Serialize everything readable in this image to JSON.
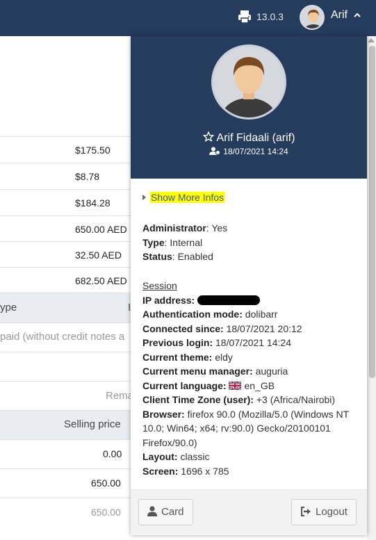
{
  "topbar": {
    "version": "13.0.3",
    "user": "Arif"
  },
  "background": {
    "amounts": [
      "$175.50",
      "$8.78",
      "$184.28",
      "650.00 AED",
      "32.50 AED",
      "682.50 AED"
    ],
    "table_header_partial": "ype",
    "table_header_right_partial": "I",
    "paid_note_partial": "paid (without credit notes a",
    "remain_partial": "Rema",
    "selling_price_header": "Selling price",
    "prices": [
      "0.00",
      "650.00",
      "650.00"
    ]
  },
  "panel": {
    "fullname": "Arif Fidaali (arif)",
    "last_login": "18/07/2021 14:24",
    "show_more": "Show More Infos",
    "fields": {
      "administrator": {
        "label": "Administrator",
        "value": "Yes"
      },
      "type": {
        "label": "Type",
        "value": "Internal"
      },
      "status": {
        "label": "Status",
        "value": "Enabled"
      }
    },
    "session": {
      "title": "Session",
      "ip_label": "IP address:",
      "auth_label": "Authentication mode:",
      "auth_value": "dolibarr",
      "connected_label": "Connected since:",
      "connected_value": "18/07/2021 20:12",
      "prev_label": "Previous login:",
      "prev_value": "18/07/2021 14:24",
      "theme_label": "Current theme:",
      "theme_value": "eldy",
      "menu_label": "Current menu manager:",
      "menu_value": "auguria",
      "lang_label": "Current language:",
      "lang_value": "en_GB",
      "tz_label": "Client Time Zone (user):",
      "tz_value": "+3 (Africa/Nairobi)",
      "browser_label": "Browser:",
      "browser_value": "firefox 90.0 (Mozilla/5.0 (Windows NT 10.0; Win64; x64; rv:90.0) Gecko/20100101 Firefox/90.0)",
      "layout_label": "Layout:",
      "layout_value": "classic",
      "screen_label": "Screen:",
      "screen_value": "1696 x 785"
    },
    "buttons": {
      "card": "Card",
      "logout": "Logout"
    }
  },
  "colors": {
    "topbar": "#263c5c",
    "highlight": "#ffff00",
    "link": "#3a5b86"
  }
}
